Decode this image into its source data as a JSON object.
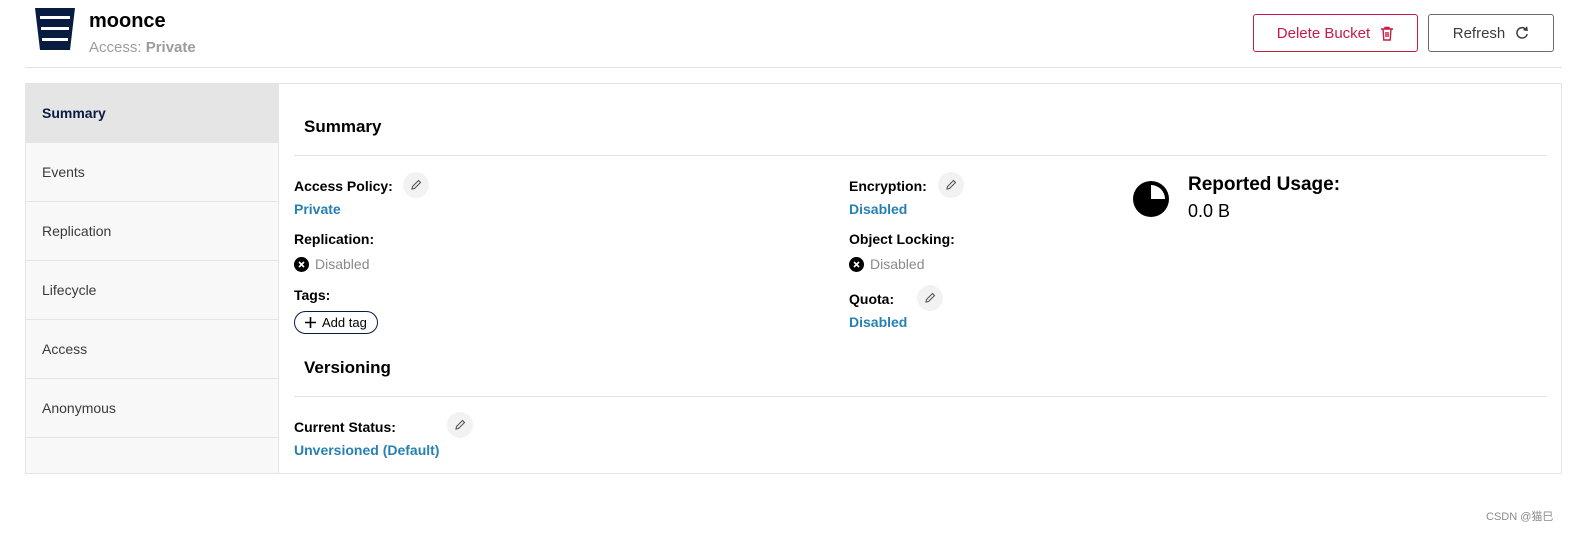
{
  "header": {
    "bucket_name": "moonce",
    "access_label": "Access:",
    "access_value": "Private",
    "delete_button": "Delete Bucket",
    "refresh_button": "Refresh",
    "delete_color": "#c51b45"
  },
  "sidebar": {
    "items": [
      {
        "label": "Summary",
        "active": true
      },
      {
        "label": "Events"
      },
      {
        "label": "Replication"
      },
      {
        "label": "Lifecycle"
      },
      {
        "label": "Access"
      },
      {
        "label": "Anonymous"
      }
    ]
  },
  "summary": {
    "title": "Summary",
    "access_policy_label": "Access Policy:",
    "access_policy_value": "Private",
    "replication_label": "Replication:",
    "replication_value": "Disabled",
    "tags_label": "Tags:",
    "add_tag_label": "Add tag",
    "encryption_label": "Encryption:",
    "encryption_value": "Disabled",
    "object_locking_label": "Object Locking:",
    "object_locking_value": "Disabled",
    "quota_label": "Quota:",
    "quota_value": "Disabled",
    "usage_title": "Reported Usage:",
    "usage_value": "0.0 B",
    "link_color": "#2781b0"
  },
  "versioning": {
    "title": "Versioning",
    "status_label": "Current Status:",
    "status_value": "Unversioned (Default)"
  },
  "watermark": "CSDN @猫巳"
}
